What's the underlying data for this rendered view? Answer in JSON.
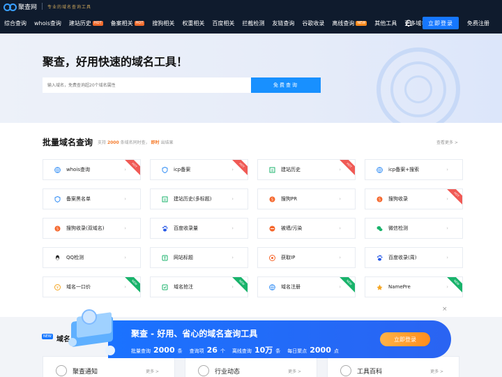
{
  "brand": {
    "name": "聚查网",
    "slogan": "专业的域名查询工具"
  },
  "nav": {
    "items": [
      {
        "label": "综合查询",
        "tag": ""
      },
      {
        "label": "whois查询",
        "tag": ""
      },
      {
        "label": "建站历史",
        "tag": "HOT"
      },
      {
        "label": "备案相关",
        "tag": "HOT"
      },
      {
        "label": "搜狗相关",
        "tag": ""
      },
      {
        "label": "权重相关",
        "tag": ""
      },
      {
        "label": "百度相关",
        "tag": ""
      },
      {
        "label": "拦截检测",
        "tag": ""
      },
      {
        "label": "友链查询",
        "tag": ""
      },
      {
        "label": "谷歌收录",
        "tag": ""
      },
      {
        "label": "离线查询",
        "tag": "NEW"
      },
      {
        "label": "其他工具",
        "tag": ""
      },
      {
        "label": "更多域名服务",
        "tag": ""
      }
    ],
    "login": "立即登录",
    "register": "免费注册"
  },
  "hero": {
    "title": "聚查，好用快速的域名工具！",
    "placeholder": "输入域名，免费查询超20个域名属性",
    "button": "免费查询"
  },
  "batch": {
    "title": "批量域名查询",
    "sub_prefix": "支持",
    "sub_count": "2000",
    "sub_mid": "条域名同时查，",
    "sub_hl": "即时",
    "sub_suffix": "出结果",
    "more": "查看更多 >"
  },
  "tools": [
    {
      "label": "whois查询",
      "icon": "globe-icon",
      "badge": "HOT",
      "color": "#2f8cf5"
    },
    {
      "label": "icp备案",
      "icon": "shield-icon",
      "badge": "HOT",
      "color": "#2f8cf5"
    },
    {
      "label": "建站历史",
      "icon": "history-icon",
      "badge": "HOT",
      "color": "#19b36b"
    },
    {
      "label": "icp备案+搜索",
      "icon": "globe-icon",
      "badge": "",
      "color": "#2f8cf5"
    },
    {
      "label": "备案黑名单",
      "icon": "shield-icon",
      "badge": "",
      "color": "#2f8cf5"
    },
    {
      "label": "建站历史(多标题)",
      "icon": "history-icon",
      "badge": "",
      "color": "#19b36b"
    },
    {
      "label": "搜狗PR",
      "icon": "sogou-icon",
      "badge": "",
      "color": "#f5662b"
    },
    {
      "label": "搜狗收录",
      "icon": "sogou-icon",
      "badge": "HOT",
      "color": "#f5662b"
    },
    {
      "label": "搜狗收录(双域名)",
      "icon": "sogou-icon",
      "badge": "",
      "color": "#f5662b"
    },
    {
      "label": "百度收录量",
      "icon": "baidu-icon",
      "badge": "",
      "color": "#2457e6"
    },
    {
      "label": "被墙/污染",
      "icon": "wall-icon",
      "badge": "",
      "color": "#f5662b"
    },
    {
      "label": "微信检测",
      "icon": "wechat-icon",
      "badge": "",
      "color": "#19b36b"
    },
    {
      "label": "QQ检测",
      "icon": "qq-icon",
      "badge": "",
      "color": "#222222"
    },
    {
      "label": "网站标题",
      "icon": "title-icon",
      "badge": "",
      "color": "#19b36b"
    },
    {
      "label": "获取IP",
      "icon": "ip-icon",
      "badge": "",
      "color": "#f5662b"
    },
    {
      "label": "百度收录(周)",
      "icon": "baidu-icon",
      "badge": "",
      "color": "#2457e6"
    },
    {
      "label": "域名一口价",
      "icon": "price-icon",
      "badge": "NEW",
      "color": "#f5a623"
    },
    {
      "label": "域名抢注",
      "icon": "grab-icon",
      "badge": "NEW",
      "color": "#19b36b"
    },
    {
      "label": "域名注册",
      "icon": "globe-icon",
      "badge": "NEW",
      "color": "#2f8cf5"
    },
    {
      "label": "NamePre",
      "icon": "namepre-icon",
      "badge": "NEW",
      "color": "#f5a623"
    }
  ],
  "banner": {
    "title": "聚查 - 好用、省心的域名查询工具",
    "stats": [
      {
        "label": "批量查询",
        "value": "2000",
        "unit": "条"
      },
      {
        "label": "查询项",
        "value": "26",
        "unit": "个"
      },
      {
        "label": "离线查询",
        "value": "10万",
        "unit": "条"
      },
      {
        "label": "每日聚点",
        "value": "2000",
        "unit": "点"
      }
    ],
    "cta": "立即登录",
    "close": "×"
  },
  "section2": {
    "tag": "NEW",
    "title": "域名"
  },
  "bottom_cards": [
    {
      "title": "聚查通知",
      "more": "更多 >"
    },
    {
      "title": "行业动态",
      "more": "更多 >"
    },
    {
      "title": "工具百科",
      "more": "更多 >"
    }
  ]
}
